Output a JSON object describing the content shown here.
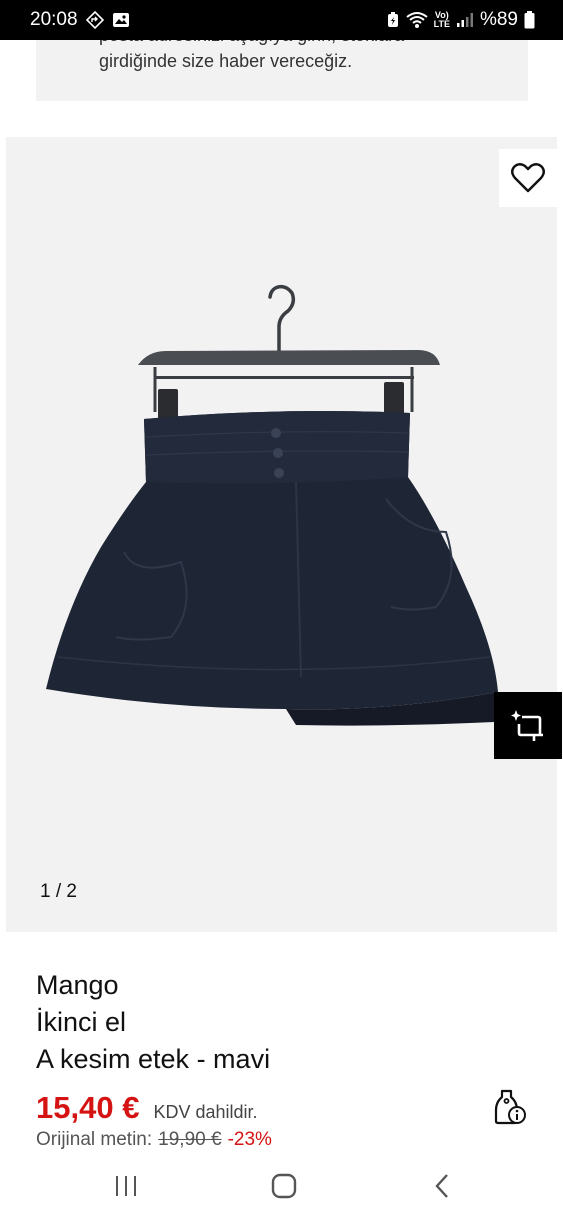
{
  "status_bar": {
    "time": "20:08",
    "network_label_top": "Vo)",
    "network_label_bottom": "LTE",
    "battery": "%89"
  },
  "notice": {
    "line1": "posta adresinizi aşağıya girin, stoklara",
    "line2": "girdiğinde size haber vereceğiz."
  },
  "gallery": {
    "counter": "1 / 2",
    "favorite_icon": "heart-outline-icon",
    "crop_icon": "crop-sparkle-icon"
  },
  "product": {
    "brand": "Mango",
    "condition": "İkinci el",
    "title": "A kesim etek - mavi",
    "price": "15,40 €",
    "vat_note": "KDV dahildir.",
    "original_label": "Orijinal metin:",
    "original_price": "19,90 €",
    "discount": "-23%",
    "price_info_icon": "price-tag-info-icon"
  },
  "nav": {
    "recents_icon": "recents-icon",
    "home_icon": "home-icon",
    "back_icon": "back-icon"
  },
  "colors": {
    "price": "#d51313",
    "gallery_bg": "#f2f2f2",
    "skirt": "#1e2535"
  }
}
